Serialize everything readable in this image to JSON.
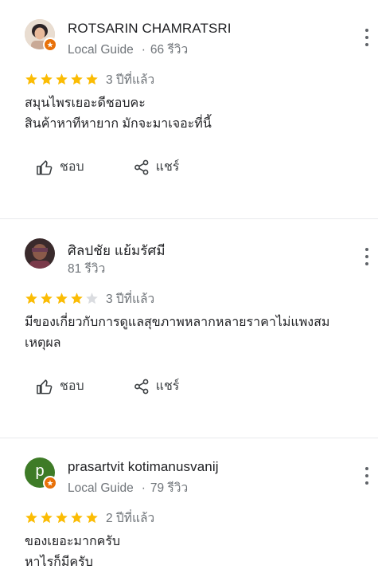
{
  "reviews": [
    {
      "name": "ROTSARIN CHAMRATSRI",
      "guide": "Local Guide",
      "count": "66 รีวิว",
      "rating": 5,
      "when": "3 ปีที่แล้ว",
      "lines": [
        "สมุนไพรเยอะดีชอบคะ",
        "สินค้าหาทีหายาก มักจะมาเจอะที่นี้"
      ],
      "like": "ชอบ",
      "share": "แชร์",
      "avatar_color": "#d7c4b3"
    },
    {
      "name": "ศิลปชัย แย้มรัศมี",
      "guide": "",
      "count": "81 รีวิว",
      "rating": 4,
      "when": "3 ปีที่แล้ว",
      "lines": [
        "มีของเกี่ยวกับการดูแลสุขภาพหลากหลายราคาไม่แพงสม",
        "เหตุผล"
      ],
      "like": "ชอบ",
      "share": "แชร์",
      "avatar_color": "#5a3b3a"
    },
    {
      "name": "prasartvit kotimanusvanij",
      "guide": "Local Guide",
      "count": "79 รีวิว",
      "rating": 5,
      "when": "2 ปีที่แล้ว",
      "lines": [
        "ของเยอะมากครับ",
        "หาไรก็มีครับ"
      ],
      "like": "ชอบ",
      "share": "แชร์",
      "avatar_letter": "p",
      "avatar_color": "#3e7b27"
    }
  ],
  "colors": {
    "star_on": "#fbbc04",
    "star_off": "#dadce0",
    "badge": "#e8710a"
  },
  "icons": [
    "thumbs-up-icon",
    "share-icon",
    "more-vert-icon",
    "star-icon",
    "local-guide-badge-icon"
  ]
}
